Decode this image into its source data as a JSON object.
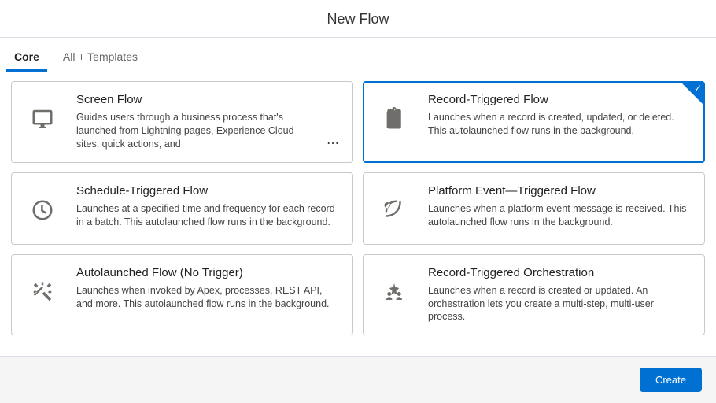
{
  "header": {
    "title": "New Flow"
  },
  "tabs": {
    "core": "Core",
    "all": "All + Templates"
  },
  "cards": {
    "screen": {
      "title": "Screen Flow",
      "desc": "Guides users through a business process that's launched from Lightning pages, Experience Cloud sites, quick actions, and"
    },
    "record": {
      "title": "Record-Triggered Flow",
      "desc": "Launches when a record is created, updated, or deleted. This autolaunched flow runs in the background."
    },
    "schedule": {
      "title": "Schedule-Triggered Flow",
      "desc": "Launches at a specified time and frequency for each record in a batch. This autolaunched flow runs in the background."
    },
    "platform": {
      "title": "Platform Event—Triggered Flow",
      "desc": "Launches when a platform event message is received. This autolaunched flow runs in the background."
    },
    "auto": {
      "title": "Autolaunched Flow (No Trigger)",
      "desc": "Launches when invoked by Apex, processes, REST API, and more. This autolaunched flow runs in the background."
    },
    "orch": {
      "title": "Record-Triggered Orchestration",
      "desc": "Launches when a record is created or updated. An orchestration lets you create a multi-step, multi-user process."
    }
  },
  "footer": {
    "create": "Create"
  },
  "colors": {
    "accent": "#0070d2"
  }
}
